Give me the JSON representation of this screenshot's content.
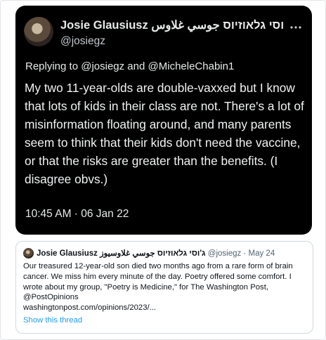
{
  "tweet": {
    "display_name": "Josie Glausiusz ג'וסי גלאוזיוס جوسي غلاوس...",
    "handle": "@josiegz",
    "replying_to_prefix": "Replying to ",
    "replying_to_user1": "@josiegz",
    "replying_to_and": " and ",
    "replying_to_user2": "@MicheleChabin1",
    "body": "My two 11-year-olds are double-vaxxed but I know that lots of kids in their class are not. There's a lot of misinformation floating around, and many parents seem to think that their kids don't need the vaccine, or that the risks are greater than the benefits. (I disagree obvs.)",
    "timestamp": "10:45 AM · 06 Jan 22",
    "more_icon": "more-horizontal-icon"
  },
  "quote": {
    "name": "Josie Glausiusz ג'וסי גלאוזיוס جوسي غلاوسيوز",
    "handle": "@josiegz",
    "separator": " · ",
    "date": "May 24",
    "body_lines": [
      "Our treasured 12-year-old son died two months ago from a rare form of brain",
      "cancer. We miss him every minute of the day. Poetry offered some comfort. I",
      "wrote about my group, \"Poetry is Medicine,\" for The Washington Post,",
      "@PostOpinions",
      "washingtonpost.com/opinions/2023/..."
    ],
    "show_thread": "Show this thread"
  },
  "colors": {
    "dark_bg": "#000000",
    "dark_text": "#e7e9ea",
    "link_blue": "#1d9bf0",
    "muted": "#536471"
  }
}
